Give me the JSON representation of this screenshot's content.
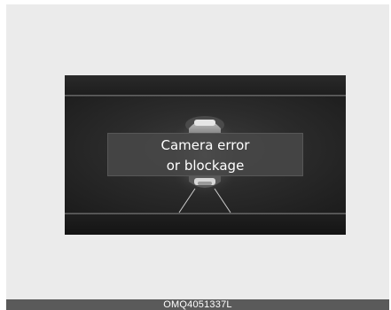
{
  "display": {
    "message_line1": "Camera error",
    "message_line2": "or blockage",
    "icon": "car-camera-icon"
  },
  "caption": {
    "code": "OMQ4051337L"
  },
  "colors": {
    "frame_background": "#ebebeb",
    "screen_background": "#222222",
    "message_box": "#464646",
    "footer_bar": "#5a5a5a"
  }
}
